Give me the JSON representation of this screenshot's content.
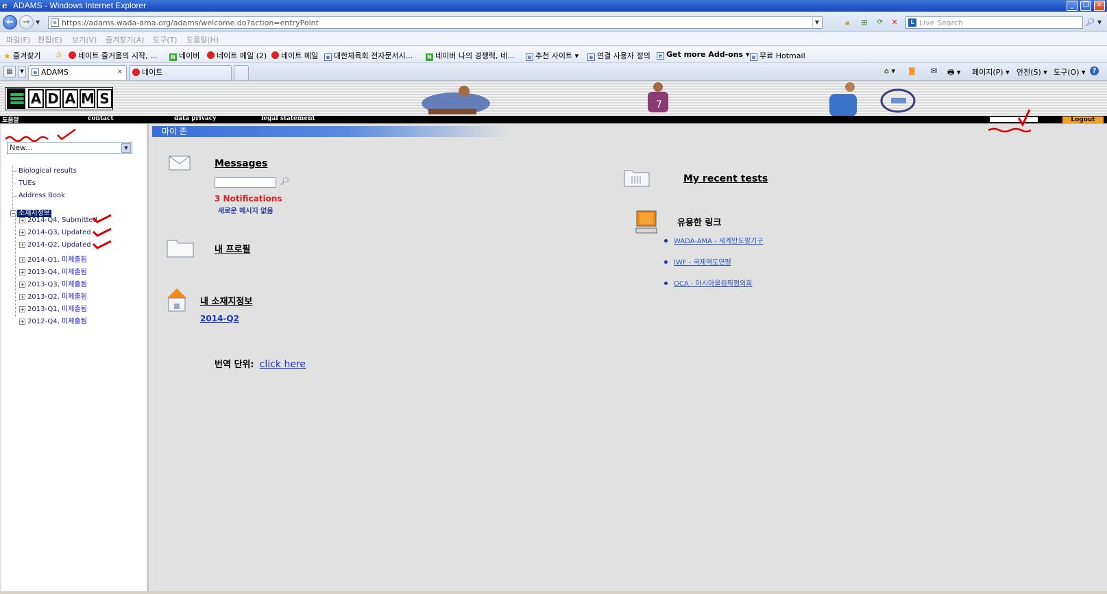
{
  "window": {
    "title": "ADAMS - Windows Internet Explorer",
    "minimize_glyph": "_",
    "maximize_glyph": "❐",
    "close_glyph": "✕"
  },
  "address_bar": {
    "url": "https://adams.wada-ama.org/adams/welcome.do?action=entryPoint",
    "search_placeholder": "Live Search"
  },
  "menu": [
    "파일(F)",
    "편집(E)",
    "보기(V)",
    "즐겨찾기(A)",
    "도구(T)",
    "도움말(H)"
  ],
  "favorites": {
    "label": "즐겨찾기",
    "items": [
      {
        "label": "네이트 즐거움의 시작, ...",
        "icon": "nate-icon"
      },
      {
        "label": "네이버",
        "icon": "naver-icon"
      },
      {
        "label": "네이트 메일 (2)",
        "icon": "nate-icon"
      },
      {
        "label": "네이트 메일",
        "icon": "nate-icon"
      },
      {
        "label": "대한체육회 전자문서시...",
        "icon": "ie-page-icon"
      },
      {
        "label": "네이버 나의 경쟁력, 네...",
        "icon": "naver-icon"
      },
      {
        "label": "추천 사이트 ▾",
        "icon": "ie-page-icon"
      },
      {
        "label": "연결 사용자 정의",
        "icon": "ie-page-icon"
      },
      {
        "label": "Get more Add-ons ▾",
        "icon": "ie-page-icon"
      },
      {
        "label": "무료 Hotmail",
        "icon": "ie-page-icon"
      }
    ]
  },
  "tabs": [
    {
      "label": "ADAMS",
      "active": true
    },
    {
      "label": "네이트",
      "active": false
    }
  ],
  "command_bar": {
    "page": "페이지(P) ▾",
    "safety": "안전(S) ▾",
    "tools": "도구(O) ▾",
    "help": "?"
  },
  "site": {
    "logo_letters": [
      "A",
      "D",
      "A",
      "M",
      "S"
    ],
    "topnav": [
      "도움말",
      "contact",
      "data privacy",
      "legal statement"
    ],
    "logout": "Logout"
  },
  "sidebar": {
    "select_value": "New...",
    "links": [
      "Biological results",
      "TUEs",
      "Address Book"
    ],
    "root_label": "소재지정보",
    "quarters": [
      {
        "period": "2014-Q4",
        "status": "Submitted"
      },
      {
        "period": "2014-Q3",
        "status": "Updated"
      },
      {
        "period": "2014-Q2",
        "status": "Updated"
      },
      {
        "period": "2014-Q1",
        "status": "미제출됨"
      },
      {
        "period": "2013-Q4",
        "status": "미제출됨"
      },
      {
        "period": "2013-Q3",
        "status": "미제출됨"
      },
      {
        "period": "2013-Q2",
        "status": "미제출됨"
      },
      {
        "period": "2013-Q1",
        "status": "미제출됨"
      },
      {
        "period": "2012-Q4",
        "status": "미제출됨"
      }
    ]
  },
  "main": {
    "section_title": "마이 존",
    "messages": {
      "title": "Messages",
      "notifications": "3 Notifications",
      "no_new": "새로운 메시지 없음"
    },
    "profile_title": "내 프로필",
    "whereabouts": {
      "title": "내 소재지정보",
      "quarter": "2014-Q2"
    },
    "translation": {
      "label": "번역 단위:",
      "link": "click here"
    },
    "recent_tests_title": "My recent tests",
    "useful_links": {
      "title": "유용한 링크",
      "items": [
        "WADA-AMA - 세계반도핑기구",
        "IWF - 국제역도연맹",
        "OCA - 아시아올림픽평의회"
      ]
    }
  },
  "colors": {
    "ie_blue": "#2256c9",
    "section_header": "#3a6fd6",
    "logout_orange": "#f0a028",
    "notification_red": "#d22020",
    "tree_selected": "#0a246a",
    "annotation_red": "#e00000"
  }
}
